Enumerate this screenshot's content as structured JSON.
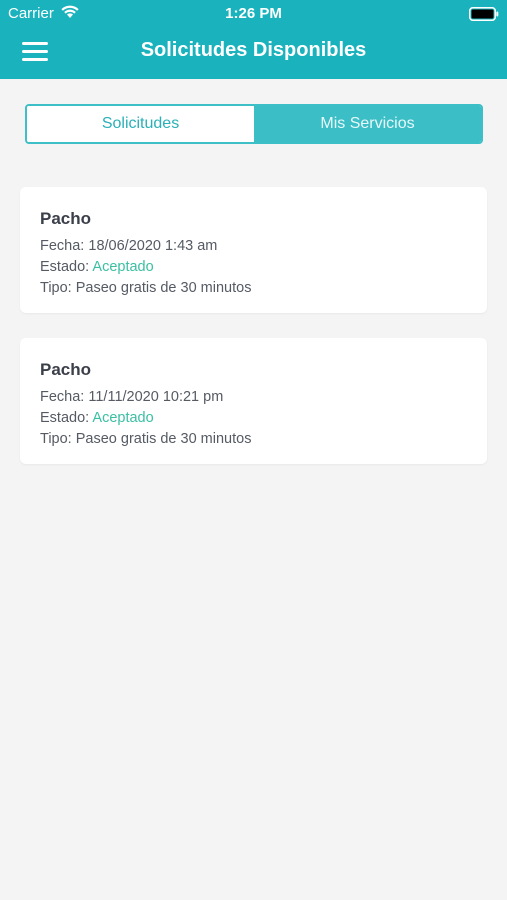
{
  "status_bar": {
    "carrier": "Carrier",
    "time": "1:26 PM"
  },
  "nav": {
    "title": "Solicitudes Disponibles",
    "menu_icon": "hamburger-menu-icon"
  },
  "tabs": [
    {
      "label": "Solicitudes",
      "selected": false
    },
    {
      "label": "Mis Servicios",
      "selected": true
    }
  ],
  "labels": {
    "fecha": "Fecha:",
    "estado": "Estado:",
    "tipo": "Tipo:"
  },
  "services": [
    {
      "name": "Pacho",
      "fecha": "18/06/2020 1:43 am",
      "estado": "Aceptado",
      "tipo": "Paseo gratis de 30 minutos"
    },
    {
      "name": "Pacho",
      "fecha": "11/11/2020 10:21 pm",
      "estado": "Aceptado",
      "tipo": "Paseo gratis de 30 minutos"
    }
  ],
  "colors": {
    "header_bg": "#1ab3bd",
    "accent": "#3bbec6",
    "status_accepted": "#3bbfa3",
    "page_bg": "#f4f4f4"
  }
}
